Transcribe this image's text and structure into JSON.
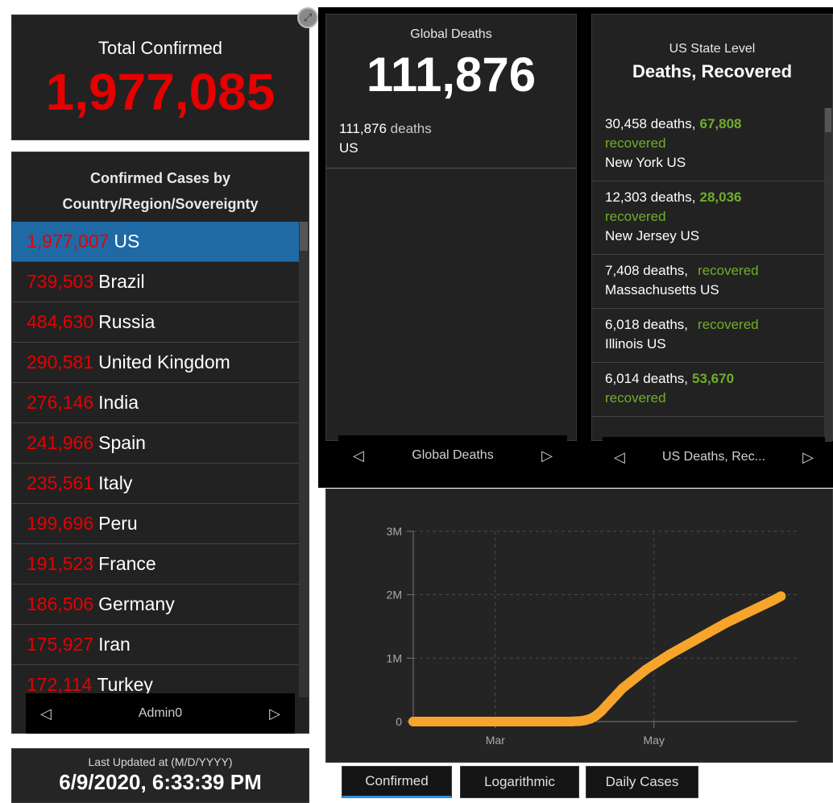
{
  "total_confirmed": {
    "label": "Total Confirmed",
    "value": "1,977,085"
  },
  "country_list": {
    "title_line1": "Confirmed Cases by",
    "title_line2": "Country/Region/Sovereignty",
    "items": [
      {
        "count": "1,977,007",
        "name": "US",
        "selected": true
      },
      {
        "count": "739,503",
        "name": "Brazil"
      },
      {
        "count": "484,630",
        "name": "Russia"
      },
      {
        "count": "290,581",
        "name": "United Kingdom"
      },
      {
        "count": "276,146",
        "name": "India"
      },
      {
        "count": "241,966",
        "name": "Spain"
      },
      {
        "count": "235,561",
        "name": "Italy"
      },
      {
        "count": "199,696",
        "name": "Peru"
      },
      {
        "count": "191,523",
        "name": "France"
      },
      {
        "count": "186,506",
        "name": "Germany"
      },
      {
        "count": "175,927",
        "name": "Iran"
      },
      {
        "count": "172,114",
        "name": "Turkey"
      }
    ],
    "nav_label": "Admin0"
  },
  "last_updated": {
    "label": "Last Updated at (M/D/YYYY)",
    "value": "6/9/2020, 6:33:39 PM"
  },
  "global_deaths": {
    "title": "Global Deaths",
    "value": "111,876",
    "items": [
      {
        "count": "111,876",
        "unit": "deaths",
        "name": "US"
      }
    ],
    "nav_label": "Global Deaths"
  },
  "us_state": {
    "title_small": "US State Level",
    "title_big": "Deaths, Recovered",
    "items": [
      {
        "deaths": "30,458 deaths,",
        "recovered_count": "67,808",
        "recovered_label": "recovered",
        "name": "New York US"
      },
      {
        "deaths": "12,303 deaths,",
        "recovered_count": "28,036",
        "recovered_label": "recovered",
        "name": "New Jersey US"
      },
      {
        "deaths": "7,408 deaths,",
        "recovered_count": "",
        "recovered_label": "recovered",
        "name": "Massachusetts US"
      },
      {
        "deaths": "6,018 deaths,",
        "recovered_count": "",
        "recovered_label": "recovered",
        "name": "Illinois US"
      },
      {
        "deaths": "6,014 deaths,",
        "recovered_count": "53,670",
        "recovered_label": "recovered",
        "name": ""
      }
    ],
    "nav_label": "US Deaths, Rec..."
  },
  "chart_tabs": [
    {
      "label": "Confirmed",
      "active": true
    },
    {
      "label": "Logarithmic"
    },
    {
      "label": "Daily Cases"
    }
  ],
  "colors": {
    "red": "#e60000",
    "green": "#70ad2b",
    "line": "#f7a42a",
    "selected": "#1f6aa5",
    "tab_active": "#2e8fdc"
  },
  "icons": {
    "expand": "expand-icon",
    "left": "chevron-left-icon",
    "right": "chevron-right-icon"
  },
  "chart_data": {
    "type": "line",
    "x_ticks": [
      "Mar",
      "May"
    ],
    "y_ticks": [
      "0",
      "1M",
      "2M",
      "3M"
    ],
    "ylim": [
      0,
      3000000
    ],
    "grid": true,
    "series": [
      {
        "values": [
          [
            0,
            0
          ],
          [
            5,
            0
          ],
          [
            10,
            0
          ],
          [
            15,
            0
          ],
          [
            20,
            0
          ],
          [
            25,
            0
          ],
          [
            30,
            0
          ],
          [
            35,
            0
          ],
          [
            40,
            0
          ],
          [
            45,
            0
          ],
          [
            50,
            0
          ],
          [
            55,
            100
          ],
          [
            60,
            1000
          ],
          [
            63,
            8000
          ],
          [
            65,
            20000
          ],
          [
            67,
            45000
          ],
          [
            69,
            90000
          ],
          [
            71,
            160000
          ],
          [
            73,
            250000
          ],
          [
            75,
            340000
          ],
          [
            77,
            430000
          ],
          [
            79,
            520000
          ],
          [
            82,
            620000
          ],
          [
            85,
            720000
          ],
          [
            88,
            820000
          ],
          [
            91,
            900000
          ],
          [
            94,
            980000
          ],
          [
            97,
            1060000
          ],
          [
            100,
            1130000
          ],
          [
            103,
            1200000
          ],
          [
            106,
            1270000
          ],
          [
            109,
            1340000
          ],
          [
            112,
            1410000
          ],
          [
            115,
            1480000
          ],
          [
            118,
            1550000
          ],
          [
            121,
            1610000
          ],
          [
            124,
            1670000
          ],
          [
            127,
            1730000
          ],
          [
            130,
            1790000
          ],
          [
            133,
            1850000
          ],
          [
            136,
            1910000
          ],
          [
            139,
            1977085
          ]
        ]
      }
    ]
  }
}
